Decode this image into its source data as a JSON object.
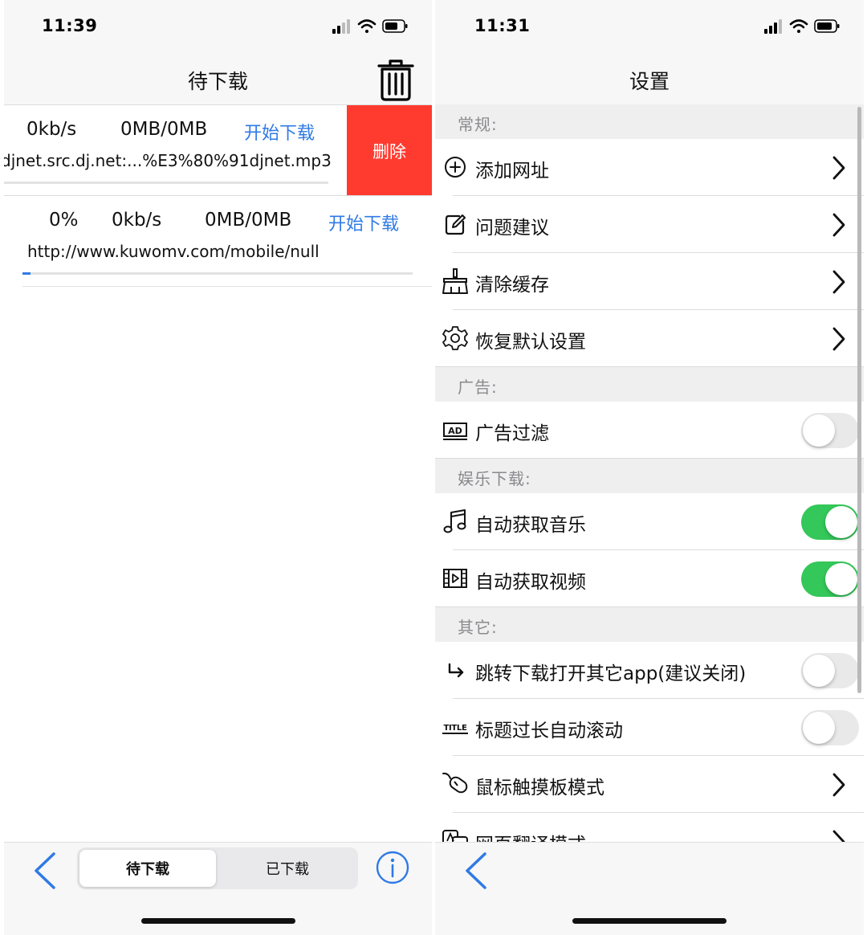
{
  "left": {
    "status_time": "11:39",
    "title": "待下载",
    "rows": [
      {
        "speed": "0kb/s",
        "size": "0MB/0MB",
        "action": "开始下载",
        "url": "djnet.src.dj.net:...%E3%80%91djnet.mp3",
        "delete_label": "删除"
      },
      {
        "percent": "0%",
        "speed": "0kb/s",
        "size": "0MB/0MB",
        "action": "开始下载",
        "url": "http://www.kuwomv.com/mobile/null",
        "progress": 0.02
      }
    ],
    "tabs": [
      "待下载",
      "已下载"
    ]
  },
  "right": {
    "status_time": "11:31",
    "title": "设置",
    "sections": {
      "general": "常规:",
      "ads": "广告:",
      "media": "娱乐下载:",
      "other": "其它:"
    },
    "items": {
      "add_url": "添加网址",
      "feedback": "问题建议",
      "clear_cache": "清除缓存",
      "restore": "恢复默认设置",
      "ad_filter": "广告过滤",
      "auto_music": "自动获取音乐",
      "auto_video": "自动获取视频",
      "jump_app": "跳转下载打开其它app(建议关闭)",
      "title_scroll": "标题过长自动滚动",
      "mouse_mode": "鼠标触摸板模式",
      "translate_mode": "网页翻译模式"
    },
    "icon_text": {
      "ad": "AD",
      "title": "TITLE"
    },
    "toggles": {
      "ad_filter": false,
      "auto_music": true,
      "auto_video": true,
      "jump_app": false,
      "title_scroll": false
    }
  },
  "colors": {
    "accent": "#2f7ae5",
    "delete": "#ff3b30",
    "toggle_on": "#34c759"
  }
}
